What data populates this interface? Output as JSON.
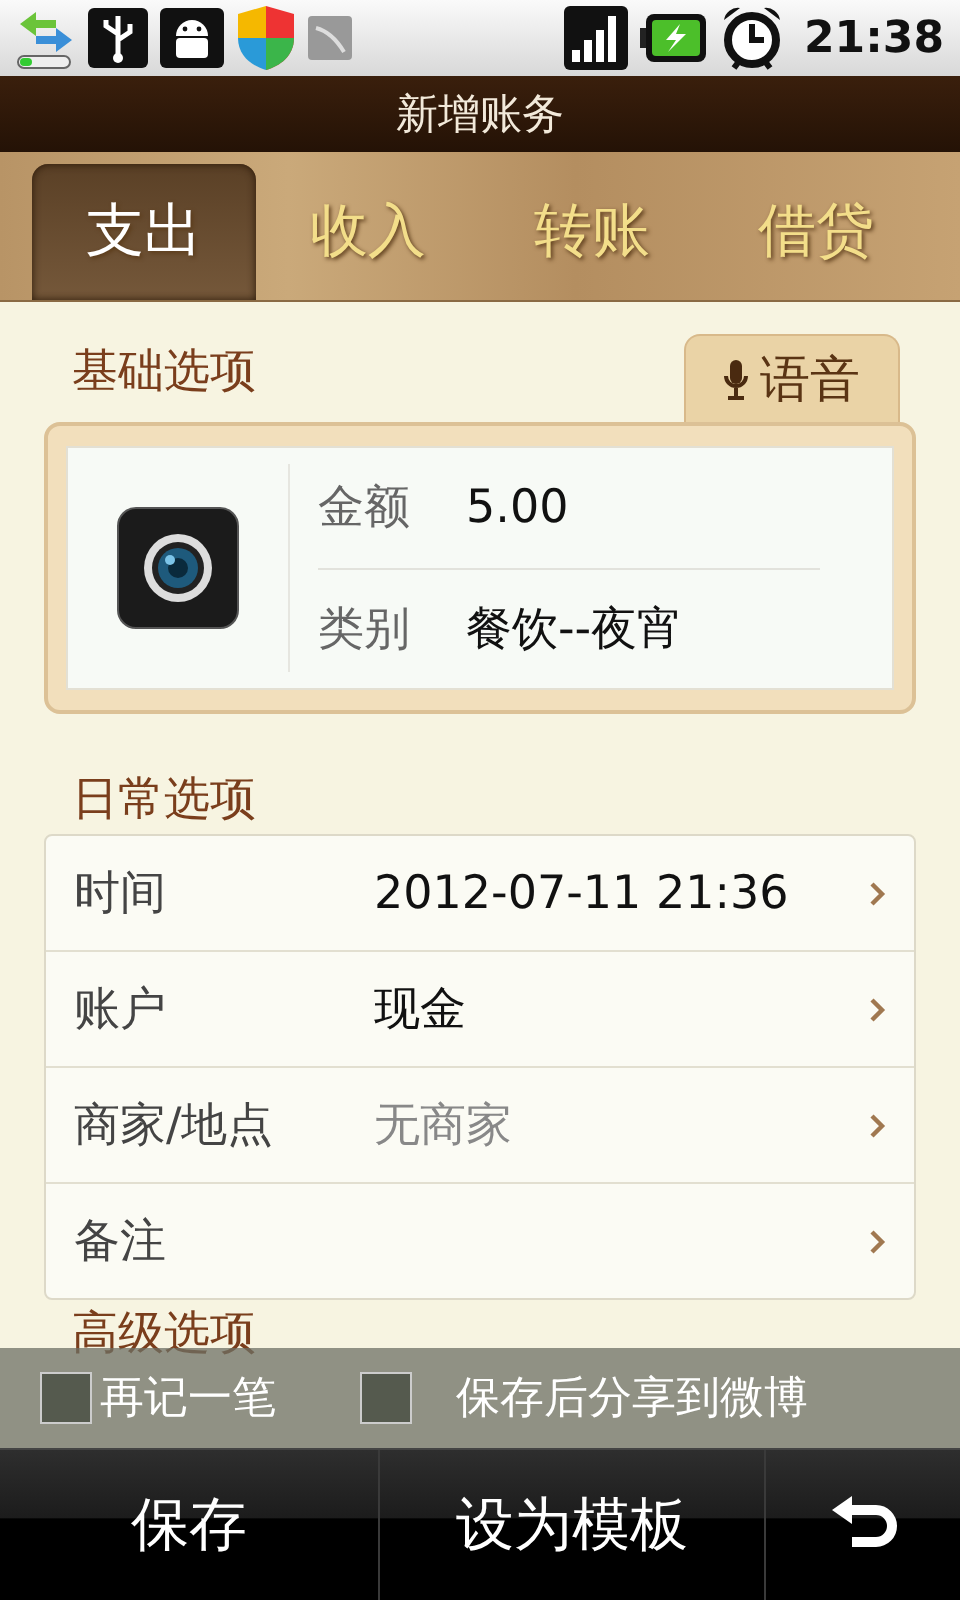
{
  "status_bar": {
    "time": "21:38"
  },
  "title": "新增账务",
  "tabs": [
    {
      "label": "支出",
      "selected": true
    },
    {
      "label": "收入",
      "selected": false
    },
    {
      "label": "转账",
      "selected": false
    },
    {
      "label": "借贷",
      "selected": false
    }
  ],
  "basic": {
    "heading": "基础选项",
    "voice_button": "语音",
    "fields": [
      {
        "label": "金额",
        "value": "5.00"
      },
      {
        "label": "类别",
        "value": "餐饮--夜宵"
      }
    ]
  },
  "daily": {
    "heading": "日常选项",
    "rows": [
      {
        "label": "时间",
        "value": "2012-07-11 21:36"
      },
      {
        "label": "账户",
        "value": "现金"
      },
      {
        "label": "商家/地点",
        "placeholder": "无商家"
      },
      {
        "label": "备注"
      }
    ]
  },
  "advanced": {
    "heading": "高级选项"
  },
  "options": [
    {
      "label": "再记一笔",
      "checked": false
    },
    {
      "label": "保存后分享到微博",
      "checked": false
    }
  ],
  "bottom_bar": {
    "buttons": [
      {
        "kind": "text",
        "label": "保存"
      },
      {
        "kind": "text",
        "label": "设为模板"
      },
      {
        "kind": "back"
      }
    ]
  }
}
